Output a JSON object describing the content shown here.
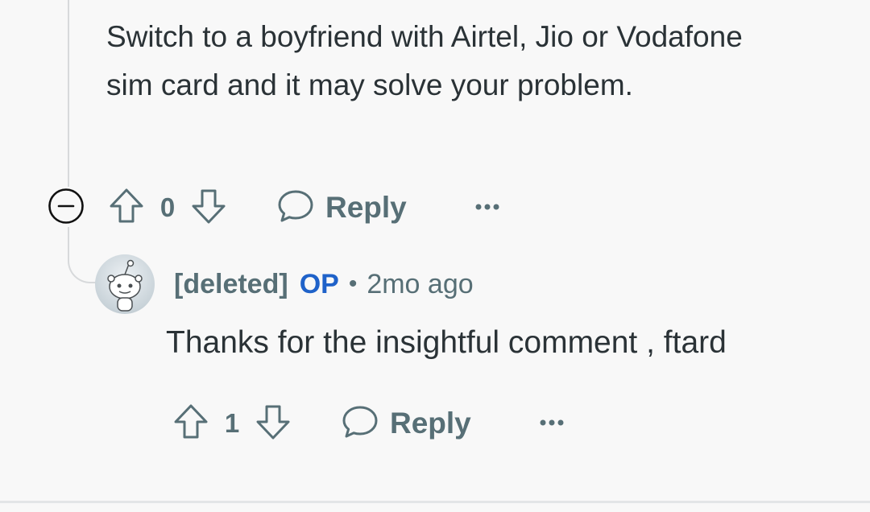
{
  "parent_comment": {
    "body": "Switch to a boyfriend with Airtel, Jio or Vodafone sim card and it may solve your problem.",
    "actions": {
      "collapse_icon": "minus-circle-icon",
      "vote_count": "0",
      "reply_label": "Reply",
      "more_icon": "ellipsis-icon"
    }
  },
  "reply_comment": {
    "avatar_icon": "snoo-avatar-icon",
    "author": "[deleted]",
    "op_badge": "OP",
    "separator": "•",
    "timestamp": "2mo ago",
    "body": "Thanks for the insightful comment , ftard",
    "actions": {
      "vote_count": "1",
      "reply_label": "Reply",
      "more_icon": "ellipsis-icon"
    }
  },
  "colors": {
    "text_primary": "#2a3236",
    "text_secondary": "#576f76",
    "op_blue": "#1f62c9",
    "thread_line": "#d7d9db",
    "background": "#f8f8f8"
  }
}
